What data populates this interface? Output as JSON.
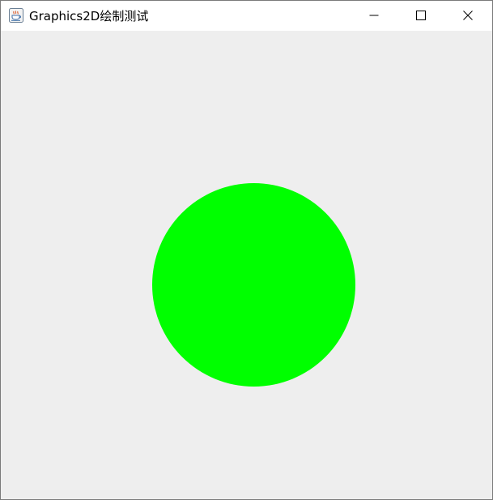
{
  "window": {
    "title": "Graphics2D绘制测试",
    "app_icon": "java-cup-icon",
    "controls": {
      "minimize_icon": "minimize-icon",
      "maximize_icon": "maximize-icon",
      "close_icon": "close-icon"
    }
  },
  "canvas": {
    "background_color": "#eeeeee",
    "shape": {
      "type": "filled-circle",
      "color": "#00ff00"
    }
  }
}
